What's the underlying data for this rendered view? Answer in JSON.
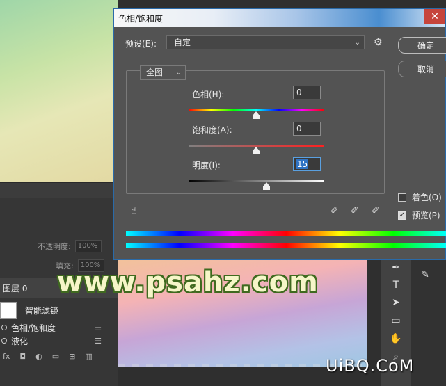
{
  "dialog": {
    "title": "色相/饱和度",
    "close_glyph": "✕",
    "preset_label": "预设(E):",
    "preset_value": "自定",
    "channel_value": "全图",
    "ok_label": "确定",
    "cancel_label": "取消",
    "hue_label": "色相(H):",
    "hue_value": "0",
    "saturation_label": "饱和度(A):",
    "saturation_value": "0",
    "lightness_label": "明度(I):",
    "lightness_value": "15",
    "colorize_label": "着色(O)",
    "colorize_checked": false,
    "preview_label": "预览(P)",
    "preview_checked": true
  },
  "layers": {
    "opacity_label": "不透明度:",
    "opacity_value": "100%",
    "fill_label": "填充:",
    "fill_value": "100%",
    "layer_tab": "图层 0",
    "smart_filter_label": "智能滤镜",
    "filters": [
      "色相/饱和度",
      "液化"
    ]
  },
  "watermarks": {
    "psahz": "www.psahz.com",
    "uibq": "UiBQ.CoM"
  },
  "icons": {
    "gear": "gear-icon",
    "target": "hand-target-icon",
    "eyedropper": "eyedropper-icon",
    "eyedropper_plus": "eyedropper-plus-icon",
    "eyedropper_minus": "eyedropper-minus-icon"
  }
}
